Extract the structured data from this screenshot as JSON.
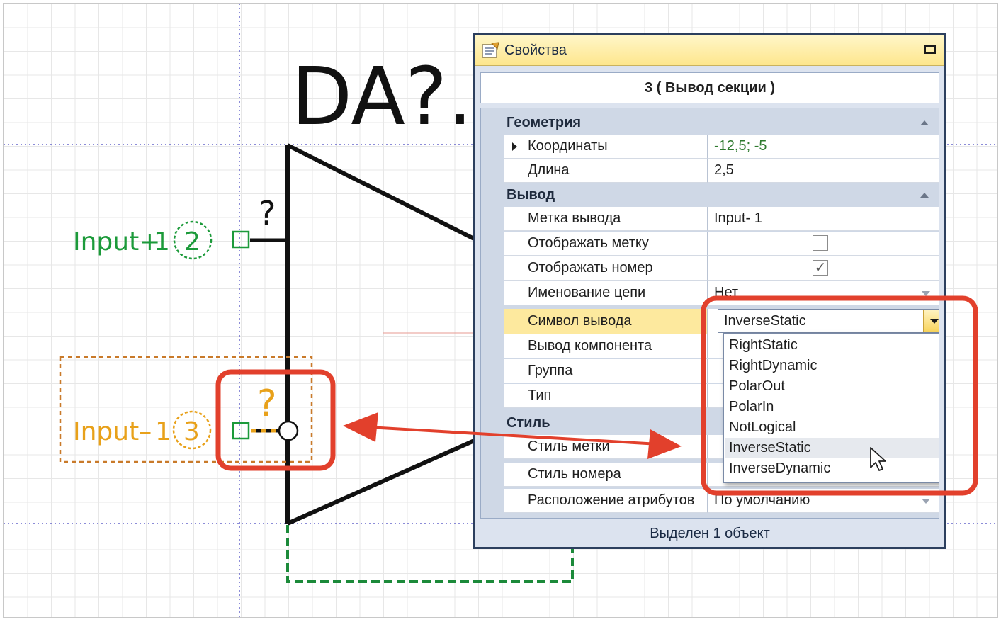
{
  "schematic": {
    "designator": "DA?.",
    "pin_top_number": "?",
    "pin_plus_label": "Input+",
    "pin_plus_num": "1",
    "pin_plus_circle": "2",
    "pin_minus_number": "?",
    "pin_minus_label": "Input–",
    "pin_minus_num": "1",
    "pin_minus_circle": "3",
    "colors": {
      "green": "#1c9a3a",
      "orange": "#e8a11a",
      "highlight": "#e2402c"
    }
  },
  "properties": {
    "title": "Свойства",
    "header": "3 ( Вывод секции )",
    "categories": [
      {
        "label": "Геометрия"
      },
      {
        "label": "Вывод"
      },
      {
        "label": "Стиль"
      }
    ],
    "geometry_rows": [
      {
        "name": "Координаты",
        "value": "-12,5; -5"
      },
      {
        "name": "Длина",
        "value": "2,5"
      }
    ],
    "pin_rows": [
      {
        "name": "Метка вывода",
        "value": "Input- 1"
      },
      {
        "name": "Отображать метку",
        "checked": false
      },
      {
        "name": "Отображать номер",
        "checked": true
      },
      {
        "name": "Именование цепи",
        "value": "Нет"
      },
      {
        "name": "Символ вывода",
        "value": "InverseStatic"
      },
      {
        "name": "Вывод компонента",
        "value": ""
      },
      {
        "name": "Группа",
        "value": ""
      },
      {
        "name": "Тип",
        "value": ""
      }
    ],
    "style_rows": [
      {
        "name": "Стиль метки",
        "value": ""
      },
      {
        "name": "Стиль номера",
        "value": ""
      },
      {
        "name": "Расположение атрибутов",
        "value": "По умолчанию"
      }
    ],
    "dropdown": {
      "options": [
        "RightStatic",
        "RightDynamic",
        "PolarOut",
        "PolarIn",
        "NotLogical",
        "InverseStatic",
        "InverseDynamic"
      ],
      "selected": "InverseStatic"
    },
    "status": "Выделен 1 объект",
    "check_mark": "✓"
  }
}
